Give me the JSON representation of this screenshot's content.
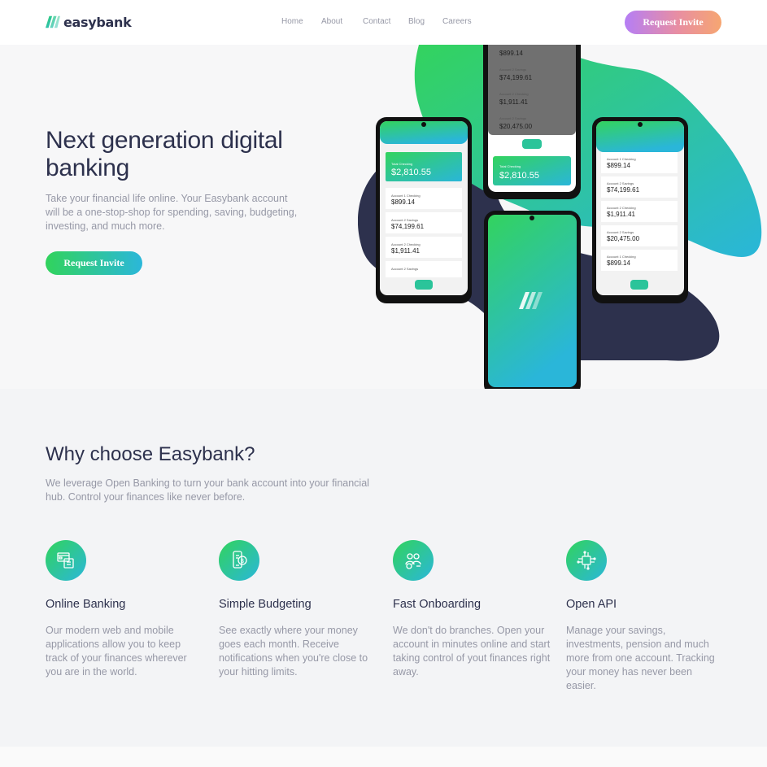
{
  "brand": {
    "name": "easybank"
  },
  "nav": {
    "items": [
      "Home",
      "About",
      "Contact",
      "Blog",
      "Careers"
    ]
  },
  "header": {
    "cta_label": "Request Invite"
  },
  "hero": {
    "title": "Next generation digital banking",
    "description": "Take your financial life online. Your Easybank account will be a one-stop-shop for spending, saving, budgeting, investing, and much more.",
    "cta_label": "Request Invite"
  },
  "phones": {
    "total_label": "Total Checking",
    "total_balance": "$2,810.55",
    "accounts": [
      {
        "label": "Account 1 Checking",
        "amount": "$899.14"
      },
      {
        "label": "Account 2 Savings",
        "amount": "$74,199.61"
      },
      {
        "label": "Account 2 Checking",
        "amount": "$1,911.41"
      },
      {
        "label": "Account 2 Savings",
        "amount": "$20,475.00"
      },
      {
        "label": "Account 1 Checking",
        "amount": "$899.14"
      }
    ]
  },
  "why": {
    "title": "Why choose Easybank?",
    "description": "We leverage Open Banking to turn your bank account into your financial hub. Control your finances like never before.",
    "features": [
      {
        "icon": "online-banking-icon",
        "title": "Online Banking",
        "description": "Our modern web and mobile applications allow you to keep track of your finances wherever you are in the world."
      },
      {
        "icon": "budgeting-icon",
        "title": "Simple Budgeting",
        "description": "See exactly where your money goes each month. Receive notifications when you're close to your hitting limits."
      },
      {
        "icon": "onboarding-icon",
        "title": "Fast Onboarding",
        "description": "We don't do branches. Open your account in minutes online and start taking control of yout finances right away."
      },
      {
        "icon": "api-icon",
        "title": "Open API",
        "description": "Manage your savings, investments, pension and much more from one account. Tracking your money has never been easier."
      }
    ]
  },
  "colors": {
    "green": "#31d35c",
    "cyan": "#2bb7da",
    "navy": "#2d314d",
    "grey": "#9698a6"
  }
}
